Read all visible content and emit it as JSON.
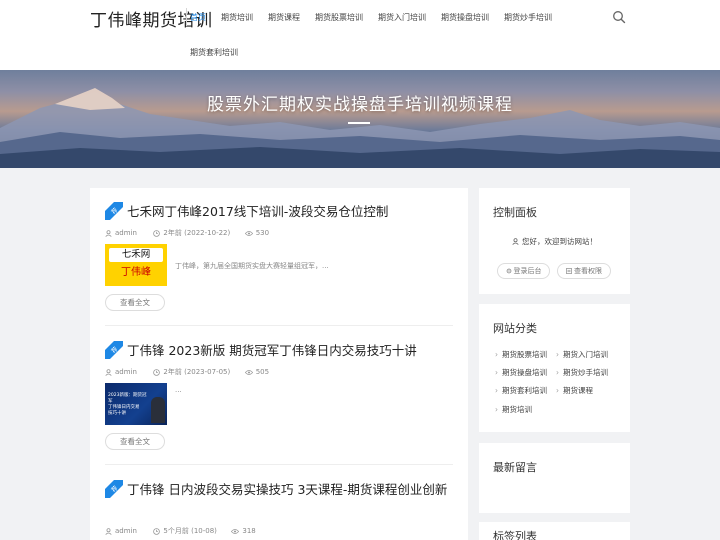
{
  "header": {
    "logo": "丁伟峰期货培训",
    "nav": [
      "首页",
      "期货培训",
      "期货课程",
      "期货股票培训",
      "期货入门培训",
      "期货操盘培训",
      "期货炒手培训",
      "期货套利培训"
    ]
  },
  "hero": {
    "title": "股票外汇期权实战操盘手培训视频课程"
  },
  "posts": [
    {
      "badge": "荐",
      "title": "七禾网丁伟峰2017线下培训-波段交易仓位控制",
      "author": "admin",
      "date": "2年前 (2022-10-22)",
      "views": "530",
      "thumb_text": [
        "七禾网",
        "丁伟峰"
      ],
      "excerpt": "丁伟峰，第九届全国期货实盘大赛轻量组冠军，...",
      "readmore": "查看全文"
    },
    {
      "badge": "荐",
      "title": "丁伟锋 2023新版 期货冠军丁伟锋日内交易技巧十讲",
      "author": "admin",
      "date": "2年前 (2023-07-05)",
      "views": "505",
      "thumb_text": [
        "2023新版：期货冠军",
        "丁伟锋日内交易",
        "技巧十讲"
      ],
      "excerpt": "...",
      "readmore": "查看全文"
    },
    {
      "badge": "荐",
      "title": "丁伟锋 日内波段交易实操技巧 3天课程-期货课程创业创新",
      "author": "admin",
      "date": "5个月前 (10-08)",
      "views": "318"
    }
  ],
  "sidebar": {
    "control_panel": {
      "title": "控制面板",
      "welcome": "您好，欢迎到访网站！",
      "login": "登录后台",
      "perm": "查看权限"
    },
    "categories": {
      "title": "网站分类",
      "items": [
        "期货股票培训",
        "期货入门培训",
        "期货操盘培训",
        "期货炒手培训",
        "期货套利培训",
        "期货课程",
        "期货培训"
      ]
    },
    "comments": {
      "title": "最新留言"
    },
    "tags": {
      "title": "标签列表"
    }
  },
  "colors": {
    "accent": "#1e88e5",
    "badge": "#1e88e5",
    "hero_text": "#ffffff"
  }
}
